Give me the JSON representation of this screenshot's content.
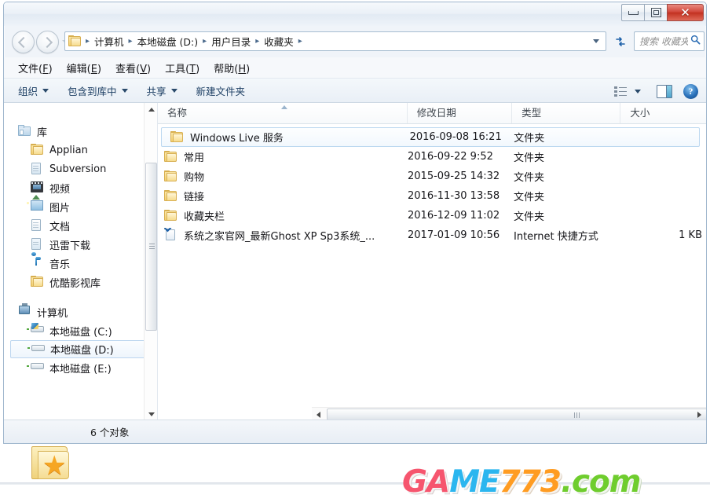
{
  "window": {
    "controls": {
      "minimize_label": "最小化",
      "maximize_label": "还原",
      "close_label": "✕"
    }
  },
  "address": {
    "back_label": "后退",
    "forward_label": "前进",
    "history_label": "最近浏览的位置",
    "folder_icon": "favorites-folder-icon",
    "breadcrumbs": [
      "计算机",
      "本地磁盘 (D:)",
      "用户目录",
      "收藏夹"
    ],
    "separator": "▸",
    "dropdown_label": "▾",
    "refresh_label": "↻"
  },
  "search": {
    "placeholder": "搜索 收藏夹",
    "icon": "search-icon"
  },
  "menubar": {
    "items": [
      {
        "text": "文件",
        "key": "F"
      },
      {
        "text": "编辑",
        "key": "E"
      },
      {
        "text": "查看",
        "key": "V"
      },
      {
        "text": "工具",
        "key": "T"
      },
      {
        "text": "帮助",
        "key": "H"
      }
    ]
  },
  "toolbar": {
    "organize_label": "组织",
    "include_library_label": "包含到库中",
    "share_label": "共享",
    "new_folder_label": "新建文件夹",
    "view_icon": "view-options-icon",
    "preview_icon": "preview-pane-icon",
    "help_icon": "help-icon",
    "help_glyph": "?"
  },
  "sidebar": {
    "groups": [
      {
        "header": {
          "label": "库",
          "icon": "library-icon"
        },
        "items": [
          {
            "label": "Applian",
            "icon": "folder-icon"
          },
          {
            "label": "Subversion",
            "icon": "document-icon"
          },
          {
            "label": "视频",
            "icon": "video-icon"
          },
          {
            "label": "图片",
            "icon": "picture-icon"
          },
          {
            "label": "文档",
            "icon": "document-icon"
          },
          {
            "label": "迅雷下载",
            "icon": "document-icon"
          },
          {
            "label": "音乐",
            "icon": "music-icon"
          },
          {
            "label": "优酷影视库",
            "icon": "folder-icon"
          }
        ]
      },
      {
        "header": {
          "label": "计算机",
          "icon": "computer-icon"
        },
        "items": [
          {
            "label": "本地磁盘 (C:)",
            "icon": "system-drive-icon",
            "selected": false
          },
          {
            "label": "本地磁盘 (D:)",
            "icon": "drive-icon",
            "selected": true
          },
          {
            "label": "本地磁盘 (E:)",
            "icon": "drive-icon",
            "selected": false
          }
        ]
      }
    ]
  },
  "filelist": {
    "columns": [
      {
        "label": "名称",
        "sorted": "asc"
      },
      {
        "label": "修改日期",
        "sorted": ""
      },
      {
        "label": "类型",
        "sorted": ""
      },
      {
        "label": "大小",
        "sorted": ""
      }
    ],
    "rows": [
      {
        "name": "Windows Live 服务",
        "date": "2016-09-08 16:21",
        "type": "文件夹",
        "size": "",
        "icon": "folder-icon",
        "selected": true
      },
      {
        "name": "常用",
        "date": "2016-09-22 9:52",
        "type": "文件夹",
        "size": "",
        "icon": "folder-icon",
        "selected": false
      },
      {
        "name": "购物",
        "date": "2015-09-25 14:32",
        "type": "文件夹",
        "size": "",
        "icon": "folder-icon",
        "selected": false
      },
      {
        "name": "链接",
        "date": "2016-11-30 13:58",
        "type": "文件夹",
        "size": "",
        "icon": "folder-icon",
        "selected": false
      },
      {
        "name": "收藏夹栏",
        "date": "2016-12-09 11:02",
        "type": "文件夹",
        "size": "",
        "icon": "folder-icon",
        "selected": false
      },
      {
        "name": "系统之家官网_最新Ghost XP Sp3系统_...",
        "date": "2017-01-09 10:56",
        "type": "Internet 快捷方式",
        "size": "1 KB",
        "icon": "internet-shortcut-icon",
        "selected": false
      }
    ]
  },
  "statusbar": {
    "item_count_text": "6 个对象",
    "folder_icon": "favorites-folder-icon"
  },
  "watermark": {
    "part1": "GA",
    "part2": "ME",
    "part3": "773",
    "part4": ".com",
    "colors": {
      "part1": "#f6556e",
      "part2": "#2bb6ef",
      "part3": "#ff9c22",
      "part4": "#6fcd2e"
    }
  }
}
